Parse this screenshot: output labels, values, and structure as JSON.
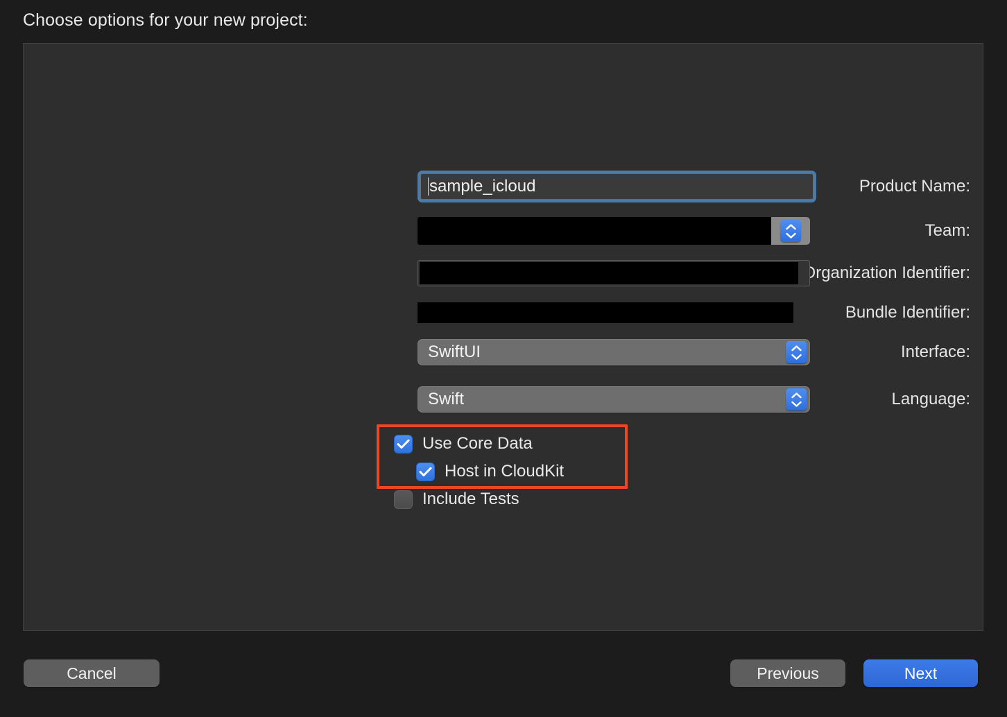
{
  "dialog": {
    "title": "Choose options for your new project:"
  },
  "form": {
    "fields": [
      {
        "label": "Product Name:",
        "type": "textfield",
        "value": "sample_icloud",
        "redacted": false,
        "focused": true
      },
      {
        "label": "Team:",
        "type": "combobox",
        "value": "",
        "redacted": true
      },
      {
        "label": "Organization Identifier:",
        "type": "textfield",
        "value": "",
        "redacted": true
      },
      {
        "label": "Bundle Identifier:",
        "type": "textfield-readonly",
        "value": "",
        "redacted": true
      },
      {
        "label": "Interface:",
        "type": "popup",
        "value": "SwiftUI"
      },
      {
        "label": "Language:",
        "type": "popup",
        "value": "Swift"
      }
    ],
    "checkboxes": [
      {
        "label": "Use Core Data",
        "checked": true,
        "indent": 0
      },
      {
        "label": "Host in CloudKit",
        "checked": true,
        "indent": 1
      },
      {
        "label": "Include Tests",
        "checked": false,
        "indent": 0
      }
    ]
  },
  "annotation": {
    "color": "#eb4626",
    "targets": "Use Core Data, Host in CloudKit"
  },
  "footer": {
    "cancel_label": "Cancel",
    "previous_label": "Previous",
    "next_label": "Next"
  },
  "colors": {
    "accent_blue": "#2f6fdc",
    "annotation_red": "#eb4626",
    "panel_bg": "#2e2e2e",
    "page_bg": "#1c1c1c",
    "focus_ring": "#4a7cab"
  }
}
